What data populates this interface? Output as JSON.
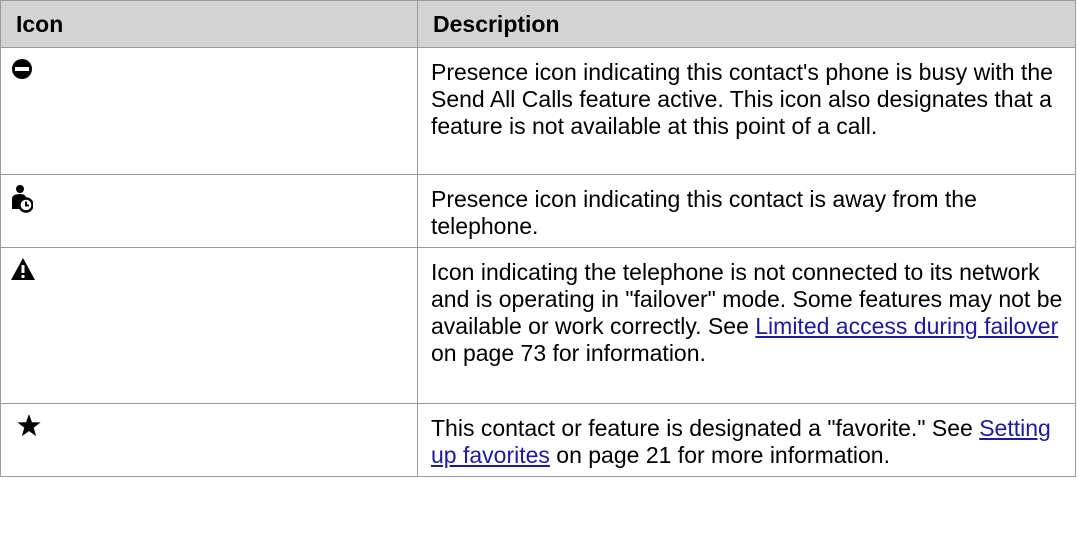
{
  "table": {
    "headers": {
      "icon": "Icon",
      "description": "Description"
    },
    "rows": [
      {
        "icon": "busy-presence-icon",
        "description": "Presence icon indicating this contact's phone is busy with the Send All Calls feature active. This icon also designates that a feature is not available at this point of a call."
      },
      {
        "icon": "away-presence-icon",
        "description": "Presence icon indicating this contact is away from the telephone."
      },
      {
        "icon": "warning-triangle-icon",
        "description_before": "Icon indicating the telephone is not connected to its network and is operating in \"failover\" mode. Some features may not be available or work correctly. See ",
        "link": "Limited access during failover",
        "description_after": " on page 73 for information."
      },
      {
        "icon": "favorite-star-icon",
        "description_before": "This contact or feature is designated a \"favorite.\" See ",
        "link": "Setting up favorites",
        "description_after": " on page 21 for more information."
      }
    ]
  },
  "colors": {
    "header_background": "#d4d4d4",
    "border": "#9a9a9a",
    "link": "#1a1aa8",
    "text": "#000000"
  }
}
